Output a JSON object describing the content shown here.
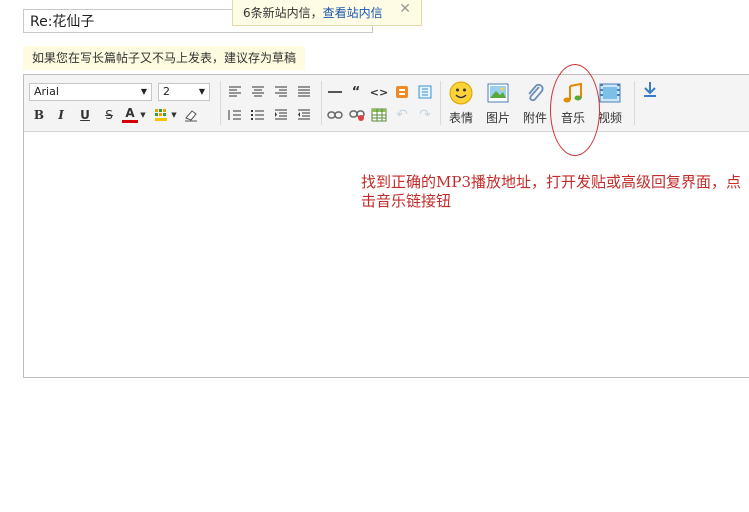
{
  "subject": {
    "value": "Re:花仙子"
  },
  "notice": {
    "text": "6条新站内信，",
    "link": "查看站内信",
    "close": "✕"
  },
  "hint": {
    "text": "如果您在写长篇帖子又不马上发表，建议存为草稿"
  },
  "toolbar": {
    "font_family": "Arial",
    "font_size": "2",
    "buttons": {
      "bold": "B",
      "italic": "I",
      "underline": "U",
      "strike": "S",
      "font_color": "A"
    },
    "big": {
      "emoticon": "表情",
      "image": "图片",
      "attachment": "附件",
      "music": "音乐",
      "video": "视频"
    }
  },
  "annotation": {
    "text": "找到正确的MP3播放地址，打开发贴或高级回复界面，点击音乐链接钮"
  },
  "colors": {
    "annotation": "#c62b2b",
    "link": "#1a55b0"
  }
}
